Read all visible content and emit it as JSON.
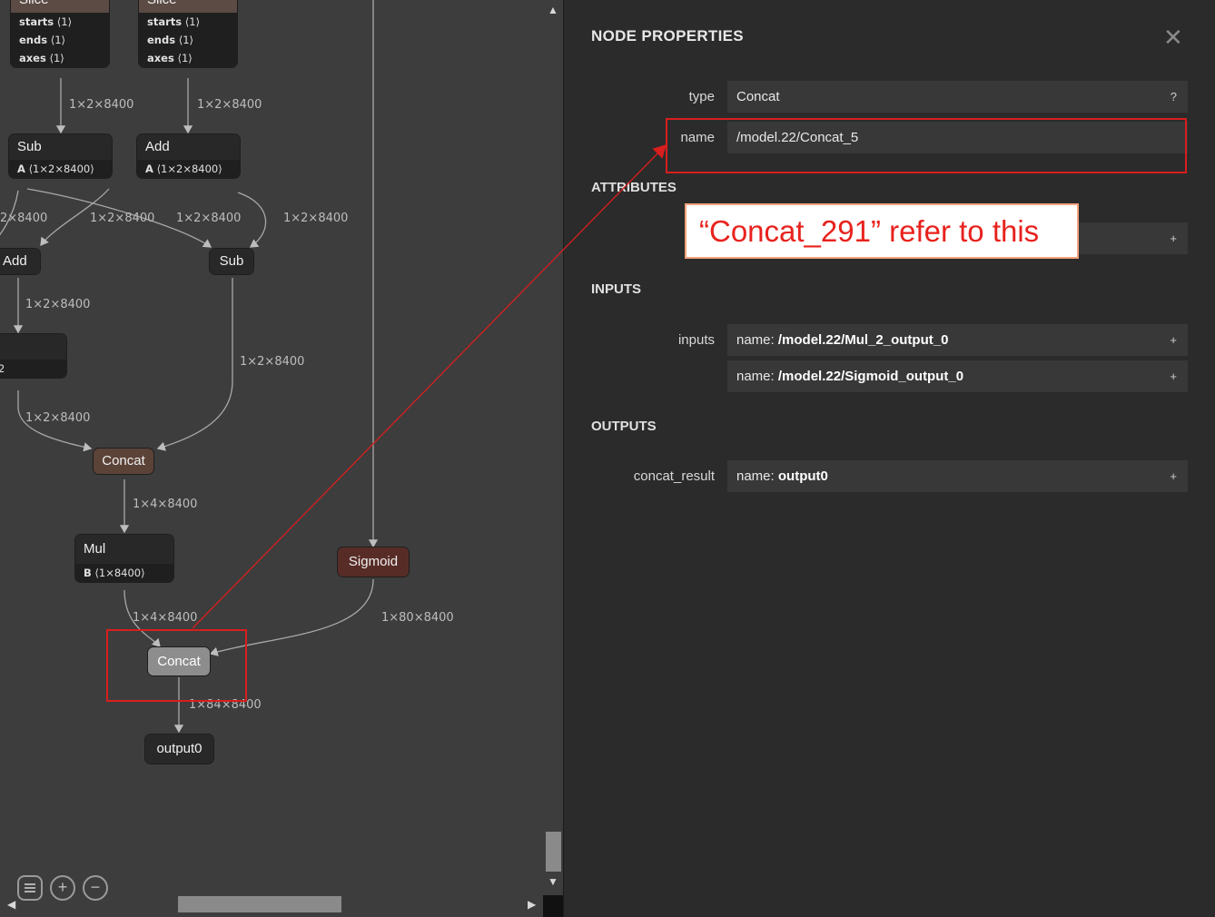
{
  "graph": {
    "nodes": {
      "slice1": {
        "title": "Slice",
        "attrs": [
          [
            "starts",
            "⟨1⟩"
          ],
          [
            "ends",
            "⟨1⟩"
          ],
          [
            "axes",
            "⟨1⟩"
          ]
        ]
      },
      "slice2": {
        "title": "Slice",
        "attrs": [
          [
            "starts",
            "⟨1⟩"
          ],
          [
            "ends",
            "⟨1⟩"
          ],
          [
            "axes",
            "⟨1⟩"
          ]
        ]
      },
      "sub1": {
        "title": "Sub",
        "attr_key": "A",
        "attr_val": "⟨1×2×8400⟩"
      },
      "add1": {
        "title": "Add",
        "attr_key": "A",
        "attr_val": "⟨1×2×8400⟩"
      },
      "add2": {
        "title": "Add"
      },
      "sub2": {
        "title": "Sub"
      },
      "partial_tail": "2",
      "concat1": {
        "title": "Concat"
      },
      "mul": {
        "title": "Mul",
        "attr_key": "B",
        "attr_val": "⟨1×8400⟩"
      },
      "sigmoid": {
        "title": "Sigmoid"
      },
      "concat2": {
        "title": "Concat"
      },
      "output": {
        "title": "output0"
      }
    },
    "edge_labels": {
      "e1": "1×2×8400",
      "e2": "1×2×8400",
      "e3": "2×8400",
      "e4": "1×2×8400",
      "e5": "1×2×8400",
      "e6": "1×2×8400",
      "e7": "1×2×8400",
      "e8": "1×2×8400",
      "e9": "1×2×8400",
      "e10": "1×4×8400",
      "e11": "1×4×8400",
      "e12": "1×80×8400",
      "e13": "1×84×8400"
    }
  },
  "panel": {
    "title": "NODE PROPERTIES",
    "type_label": "type",
    "type_value": "Concat",
    "type_help": "?",
    "name_label": "name",
    "name_value": "/model.22/Concat_5",
    "attributes_title": "ATTRIBUTES",
    "attribute_expand": "+",
    "inputs_title": "INPUTS",
    "inputs_label": "inputs",
    "inputs": [
      {
        "key": "name:",
        "value": "/model.22/Mul_2_output_0",
        "expand": "+"
      },
      {
        "key": "name:",
        "value": "/model.22/Sigmoid_output_0",
        "expand": "+"
      }
    ],
    "outputs_title": "OUTPUTS",
    "outputs_label": "concat_result",
    "output": {
      "key": "name:",
      "value": "output0",
      "expand": "+"
    }
  },
  "annotation": {
    "callout_text": "“Concat_291” refer to this",
    "color": "#d81e1e"
  },
  "toolbar": {
    "icons": [
      "list-icon",
      "zoom-in-icon",
      "zoom-out-icon"
    ],
    "zoom_in_glyph": "+",
    "zoom_out_glyph": "−"
  },
  "scroll": {
    "up_arrow": "▲",
    "down_arrow": "▼",
    "left_arrow": "◀",
    "right_arrow": "▶"
  }
}
